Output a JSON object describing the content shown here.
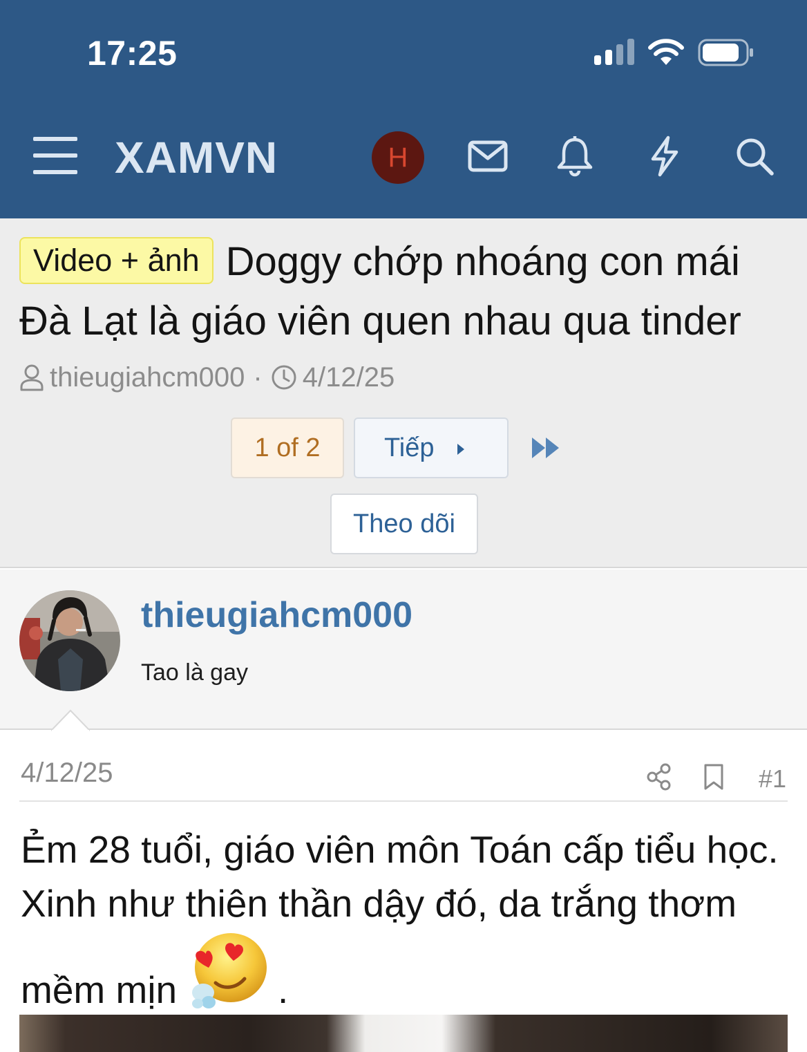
{
  "status_bar": {
    "time": "17:25",
    "icons": [
      "cellular-signal-icon",
      "wifi-icon",
      "battery-icon"
    ]
  },
  "header": {
    "brand": "XAMVN",
    "avatar_initial": "H",
    "icons": [
      "menu-icon",
      "mail-icon",
      "bell-icon",
      "lightning-icon",
      "search-icon"
    ],
    "colors": {
      "bar": "#2d5886",
      "avatar_bg": "#5c1711",
      "avatar_letter": "#d9472f"
    }
  },
  "thread": {
    "prefix": "Video + ảnh",
    "title": "Doggy chớp nhoáng con mái Đà Lạt là giáo viên quen nhau qua tinder",
    "author": "thieugiahcm000",
    "separator": "·",
    "date": "4/12/25",
    "pagination": {
      "current_label": "1 of 2",
      "next_label": "Tiếp"
    },
    "follow_label": "Theo dõi"
  },
  "post": {
    "username": "thieugiahcm000",
    "user_title": "Tao là gay",
    "date": "4/12/25",
    "number": "#1",
    "body_line1": "Ẻm 28 tuổi, giáo viên môn Toán cấp tiểu học.",
    "body_line2": "Xinh như thiên thần dậy đó, da trắng thơm",
    "body_line3": "mềm mịn",
    "body_end": ".",
    "emoji": "heart-eyes-drooling-emoji"
  }
}
